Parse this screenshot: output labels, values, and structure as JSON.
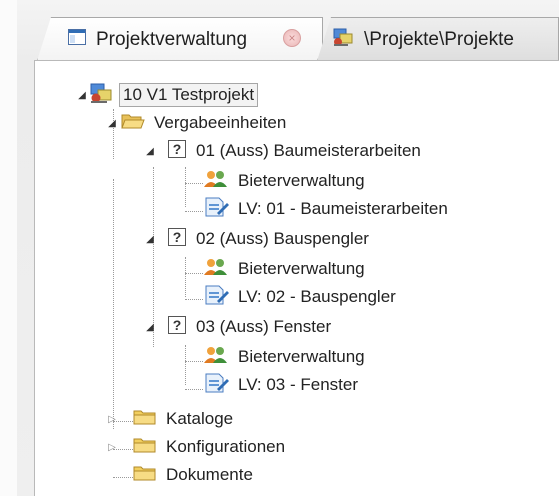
{
  "tabs": [
    {
      "label": "Projektverwaltung",
      "icon": "window-icon"
    },
    {
      "label": "\\Projekte\\Projekte",
      "icon": "project-icon"
    }
  ],
  "tree": {
    "root": {
      "label": "10 V1 Testprojekt",
      "icon": "project-icon"
    },
    "vergabe": {
      "label": "Vergabeeinheiten",
      "icon": "folder-open-icon"
    },
    "items": [
      {
        "label": "01 (Auss) Baumeisterarbeiten",
        "bieter": "Bieterverwaltung",
        "lv": "LV: 01 - Baumeisterarbeiten"
      },
      {
        "label": "02 (Auss) Bauspengler",
        "bieter": "Bieterverwaltung",
        "lv": "LV: 02 - Bauspengler"
      },
      {
        "label": "03 (Auss) Fenster",
        "bieter": "Bieterverwaltung",
        "lv": "LV: 03 - Fenster"
      }
    ],
    "kataloge": {
      "label": "Kataloge"
    },
    "konfigurationen": {
      "label": "Konfigurationen"
    },
    "dokumente": {
      "label": "Dokumente"
    }
  }
}
